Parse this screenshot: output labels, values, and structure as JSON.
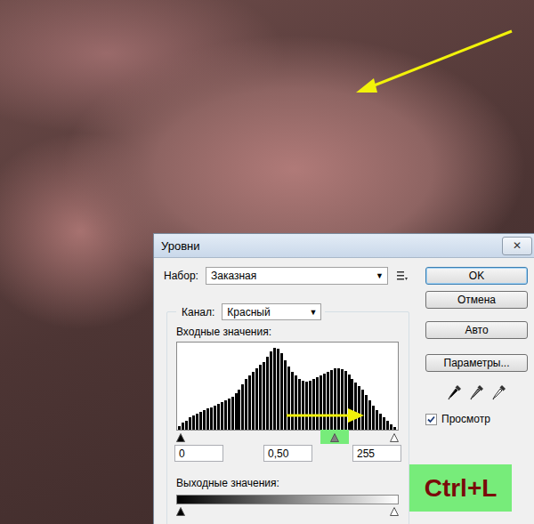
{
  "window": {
    "title": "Уровни",
    "close": "✕"
  },
  "preset": {
    "label": "Набор:",
    "value": "Заказная",
    "arrow": "▼"
  },
  "channel": {
    "label": "Канал:",
    "value": "Красный",
    "arrow": "▼"
  },
  "input_levels": {
    "label": "Входные значения:",
    "histogram": [
      4,
      8,
      10,
      14,
      16,
      18,
      20,
      22,
      24,
      26,
      28,
      30,
      32,
      34,
      36,
      38,
      42,
      46,
      52,
      58,
      62,
      66,
      70,
      74,
      78,
      84,
      90,
      94,
      93,
      88,
      80,
      72,
      66,
      62,
      58,
      56,
      55,
      56,
      58,
      60,
      62,
      64,
      66,
      68,
      70,
      70,
      69,
      67,
      63,
      58,
      54,
      50,
      46,
      40,
      34,
      28,
      22,
      18,
      14,
      10,
      6,
      3
    ],
    "sliders": [
      {
        "level": 0,
        "color": "#000000",
        "highlighted": false
      },
      {
        "level": 0.72,
        "color": "#808080",
        "highlighted": true
      },
      {
        "level": 1,
        "color": "#ffffff",
        "highlighted": false
      }
    ],
    "fields": [
      "0",
      "0,50",
      "255"
    ]
  },
  "output_levels": {
    "label": "Выходные значения:",
    "sliders": [
      {
        "level": 0,
        "color": "#000000"
      },
      {
        "level": 1,
        "color": "#ffffff"
      }
    ]
  },
  "buttons": [
    {
      "label": "OK",
      "default": true
    },
    {
      "label": "Отмена",
      "default": false
    },
    {
      "label": "Авто",
      "default": false
    },
    {
      "label": "Параметры...",
      "default": false
    }
  ],
  "eyedroppers": [
    {
      "color": "#000000"
    },
    {
      "color": "#808080"
    },
    {
      "color": "#ffffff"
    }
  ],
  "preview": {
    "label": "Просмотр",
    "checked": true
  },
  "annotation": {
    "label": "Ctrl+L"
  }
}
